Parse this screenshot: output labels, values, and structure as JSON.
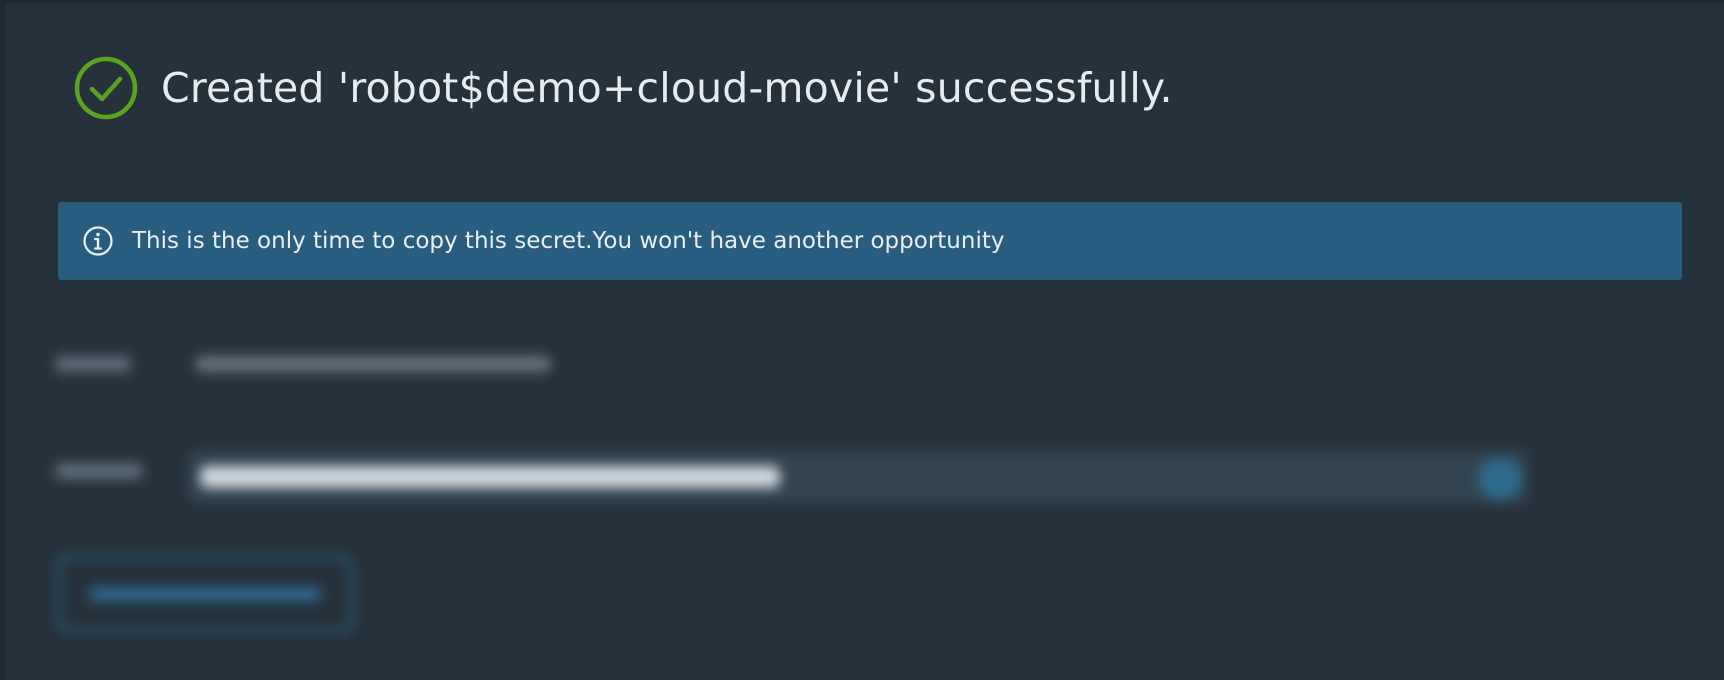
{
  "dialog": {
    "title": "Created 'robot$demo+cloud-movie' successfully.",
    "success_icon": "check-circle-icon",
    "success_color": "#5aa220"
  },
  "alert": {
    "icon": "info-circle-icon",
    "text": "This is the only time to copy this secret.You won't have another opportunity",
    "background": "#295d80"
  }
}
